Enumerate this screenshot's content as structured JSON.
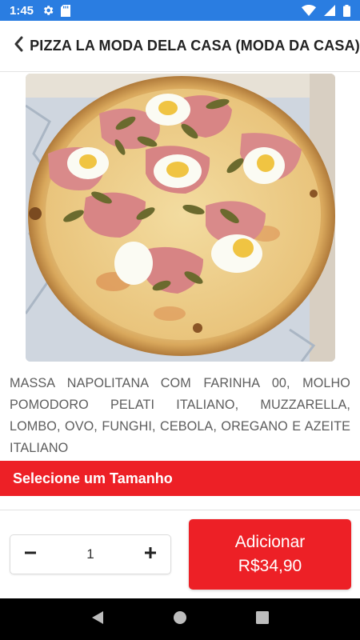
{
  "status_bar": {
    "time": "1:45",
    "icons": [
      "gear-icon",
      "sd-card-icon",
      "wifi-icon",
      "signal-icon",
      "battery-icon"
    ],
    "color": "#2a7de1"
  },
  "header": {
    "title": "PIZZA LA MODA DELA CASA (MODA DA CASA)",
    "back_icon": "chevron-left-icon"
  },
  "product": {
    "image_description": "pizza-photo",
    "description": "MASSA NAPOLITANA COM FARINHA 00, MOLHO POMODORO PELATI ITALIANO, MUZZARELLA, LOMBO, OVO, FUNGHI, CEBOLA, OREGANO E AZEITE ITALIANO"
  },
  "size_section": {
    "label": "Selecione um Tamanho",
    "color": "#ed2026"
  },
  "quantity": {
    "value": "1",
    "minus_icon": "minus-icon",
    "plus_icon": "plus-icon"
  },
  "add_button": {
    "label": "Adicionar",
    "price": "R$34,90",
    "color": "#ed2026"
  },
  "nav_bar": {
    "buttons": [
      "back-triangle-icon",
      "home-circle-icon",
      "recents-square-icon"
    ]
  }
}
